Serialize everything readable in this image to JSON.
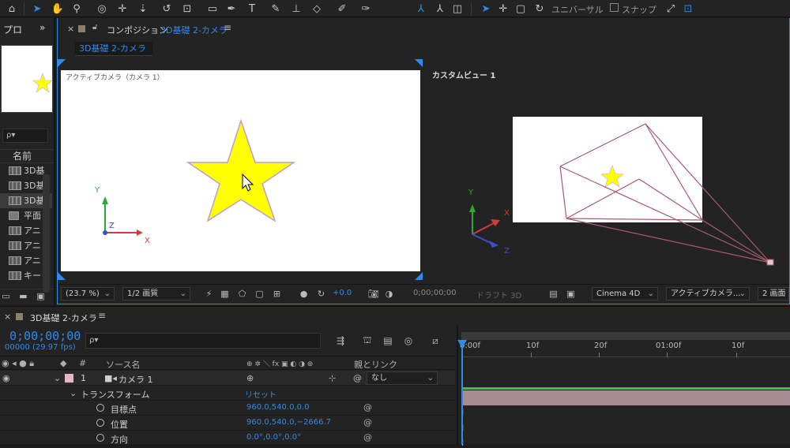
{
  "toolbar": {
    "universal_label": "ユニバーサル",
    "snap_label": "スナップ"
  },
  "project": {
    "tab_label": "プロ",
    "more": "»",
    "search_placeholder": "ρ▾",
    "name_header": "名前",
    "items": [
      "3D基",
      "3D基",
      "3D基",
      "平面",
      "アニ",
      "アニ",
      "アニ",
      "キー"
    ]
  },
  "composition": {
    "close": "×",
    "title_prefix": "コンポジション",
    "title_name": "3D基礎 2-カメラ",
    "menu": "≡",
    "subtab": "3D基礎 2-カメラ",
    "left_view_label": "アクティブカメラ（カメラ 1）",
    "right_view_label": "カスタムビュー 1",
    "axis_y": "Y",
    "axis_x": "X",
    "axis_z": "Z",
    "footer": {
      "zoom": "(23.7 %)",
      "resolution": "1/2 画質",
      "exposure": "+0.0",
      "timecode": "0;00;00;00",
      "draft3d": "ドラフト 3D",
      "renderer": "Cinema 4D",
      "camera": "アクティブカメラ...",
      "views": "2 画面"
    }
  },
  "timeline": {
    "close": "×",
    "title": "3D基礎 2-カメラ",
    "menu": "≡",
    "timecode": "0;00;00;00",
    "fps": "00000 (29.97 fps)",
    "search_placeholder": "ρ▾",
    "columns": {
      "hash": "#",
      "source_name": "ソース名",
      "switches": "⊕ ✲ ＼ fx ▣ ◐ ◑ ⊛",
      "parent": "親とリンク"
    },
    "layer": {
      "number": "1",
      "name": "カメラ 1",
      "parent_value": "なし"
    },
    "transform": {
      "label": "トランスフォーム",
      "reset": "リセット",
      "properties": [
        {
          "name": "目標点",
          "value": "960.0,540.0,0.0"
        },
        {
          "name": "位置",
          "value": "960.0,540.0,−2666.7"
        },
        {
          "name": "方向",
          "value": "0.0°,0.0°,0.0°"
        }
      ]
    },
    "ruler": [
      "0:00f",
      "10f",
      "20f",
      "01:00f",
      "10f"
    ]
  },
  "colors": {
    "accent": "#2d8ceb",
    "star_fill": "#ffff00",
    "camera_bar": "#a78a92",
    "green_line": "#3ec243"
  }
}
